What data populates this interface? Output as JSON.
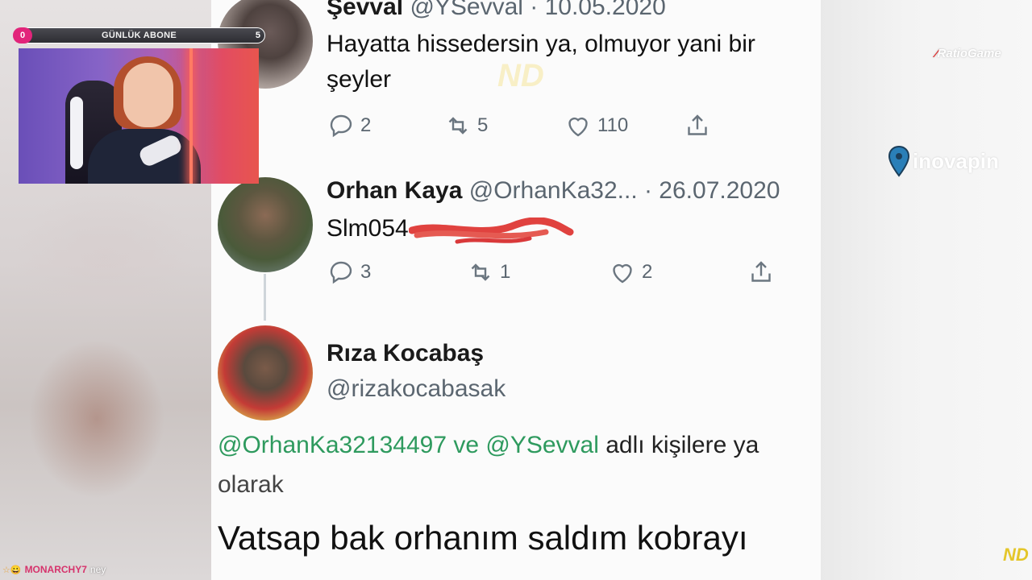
{
  "subscriber_goal": {
    "title": "GÜNLÜK ABONE",
    "current": "0",
    "target": "5"
  },
  "tweets": {
    "sevval": {
      "name": "Şevval",
      "meta": "@YSevval · 10.05.2020",
      "text_line1": "Hayatta hissedersin ya, olmuyor yani bir",
      "text_line2": "şeyler",
      "replies": "2",
      "retweets": "5",
      "likes": "110"
    },
    "orhan": {
      "name": "Orhan Kaya",
      "meta": "@OrhanKa32... · 26.07.2020",
      "text": "Slm054",
      "replies": "3",
      "retweets": "1",
      "likes": "2"
    },
    "riza": {
      "name": "Rıza Kocabaş",
      "handle": "@rizakocabasak",
      "mention1": "@OrhanKa32134497",
      "connector": " ve ",
      "mention2": "@YSevval",
      "reply_suffix": " adlı kişilere ya",
      "reply_line2": "olarak",
      "text": "Vatsap bak orhanım saldım kobrayı"
    }
  },
  "branding": {
    "ratio": "RatioGame",
    "pin_brand": "inovapin",
    "watermark": "ND"
  },
  "chat": {
    "badges": "☆😀",
    "username": "MONARCHY7",
    "message": "ney"
  },
  "icons": [
    "reply-icon",
    "retweet-icon",
    "like-icon",
    "share-icon",
    "pin-icon"
  ],
  "colors": {
    "mention": "#2e9a5e",
    "goal_start": "#e22a7a",
    "chat_user": "#d6336c"
  }
}
